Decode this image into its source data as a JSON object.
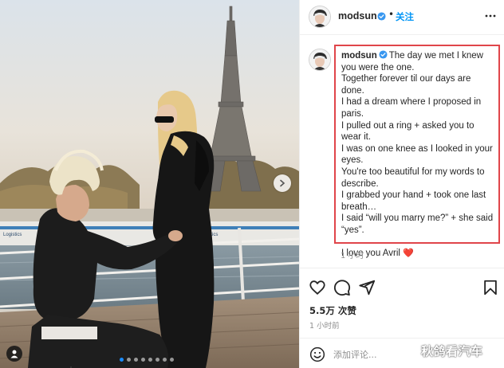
{
  "post": {
    "username": "modsun",
    "follow_label": "关注",
    "separator": "•",
    "caption": {
      "username": "modsun",
      "text": "The day we met I knew you were the one.\nTogether forever til our days are done.\nI had a dream where I proposed in paris.\nI pulled out a ring + asked you to wear it.\nI was on one knee as I looked in your eyes.\nYou're too beautiful for my words to describe.\nI grabbed your hand + took one last breath…\nI said “will you marry me?” + she said “yes”.\n\nI love you Avril",
      "heart": "❤️",
      "time": "1 小时"
    },
    "likes": "5.5万 次赞",
    "post_time": "1 小时前",
    "comment_placeholder": "添加评论...",
    "carousel": {
      "total_slides": 8,
      "active_slide": 1
    }
  },
  "icons": {
    "verified": "verified-badge-icon",
    "more": "more-options-icon",
    "like": "heart-icon",
    "comment": "comment-icon",
    "share": "share-icon",
    "save": "bookmark-icon",
    "emoji": "emoji-icon",
    "next": "chevron-right-icon",
    "tag": "user-tag-icon"
  },
  "watermark": "秋鸽看汽车",
  "colors": {
    "accent": "#0095f6",
    "highlight_border": "#e0454a",
    "verified": "#3897f0",
    "heart": "#e8232b"
  }
}
